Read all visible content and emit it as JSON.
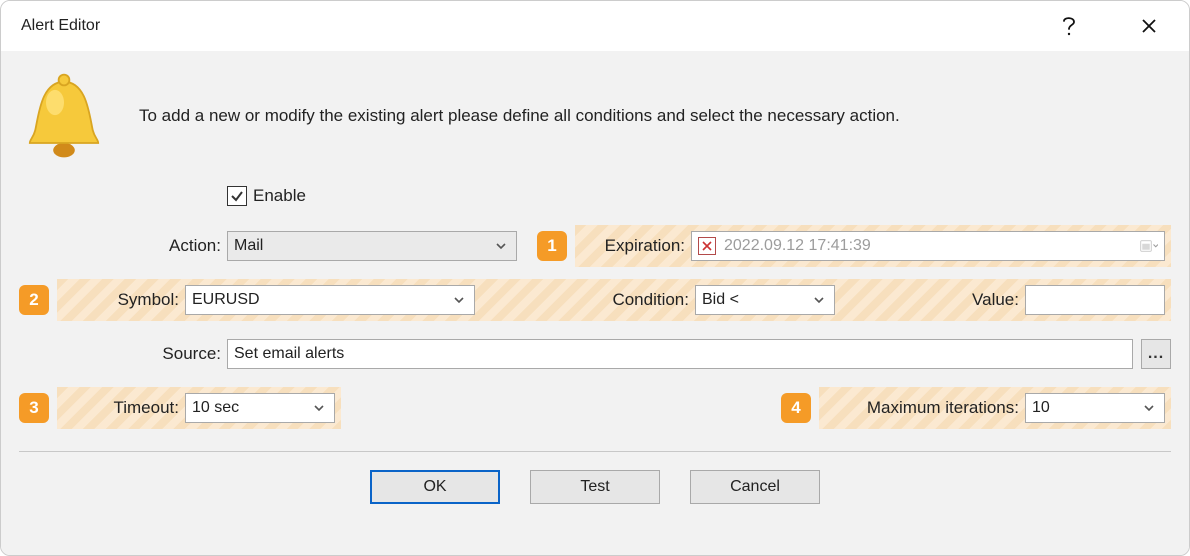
{
  "window": {
    "title": "Alert Editor"
  },
  "intro": "To add a new or modify the existing alert please define all conditions and select the necessary action.",
  "enable": {
    "label": "Enable",
    "checked": true
  },
  "badges": {
    "one": "1",
    "two": "2",
    "three": "3",
    "four": "4"
  },
  "labels": {
    "action": "Action:",
    "expiration": "Expiration:",
    "symbol": "Symbol:",
    "condition": "Condition:",
    "value": "Value:",
    "source": "Source:",
    "timeout": "Timeout:",
    "maxiter": "Maximum iterations:"
  },
  "values": {
    "action": "Mail",
    "expiration": "2022.09.12 17:41:39",
    "symbol": "EURUSD",
    "condition": "Bid <",
    "value": "",
    "source": "Set email alerts",
    "timeout": "10 sec",
    "maxiter": "10"
  },
  "buttons": {
    "ok": "OK",
    "test": "Test",
    "cancel": "Cancel",
    "ellipsis": "..."
  }
}
